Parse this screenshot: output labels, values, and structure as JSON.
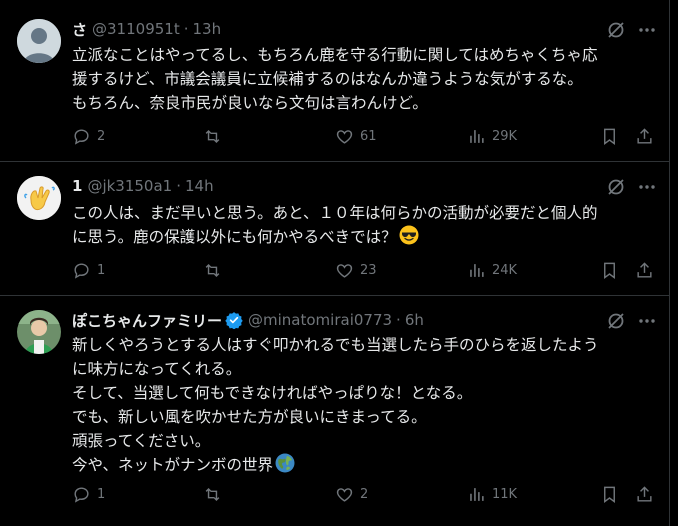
{
  "tweets": [
    {
      "name": "さ",
      "handle": "@3110951t",
      "dot": "·",
      "time": "13h",
      "lines": [
        "立派なことはやってるし、もちろん鹿を守る行動に関してはめちゃくちゃ応",
        "援するけど、市議会議員に立候補するのはなんか違うような気がするな。",
        "もちろん、奈良市民が良いなら文句は言わんけど。"
      ],
      "replies": "2",
      "reposts": "",
      "likes": "61",
      "views": "29K"
    },
    {
      "name": "1",
      "handle": "@jk3150a1",
      "dot": "·",
      "time": "14h",
      "lines": [
        "この人は、まだ早いと思う。あと、１０年は何らかの活動が必要だと個人的",
        "に思う。鹿の保護以外にも何かやるべきでは？"
      ],
      "emoji": "smiling-face-with-sunglasses",
      "replies": "1",
      "reposts": "",
      "likes": "23",
      "views": "24K"
    },
    {
      "name": "ぽこちゃんファミリー",
      "handle": "@minatomirai0773",
      "dot": "·",
      "time": "6h",
      "verified": true,
      "lines": [
        "新しくやろうとする人はすぐ叩かれるでも当選したら手のひらを返したよう",
        "に味方になってくれる。",
        "そして、当選して何もできなければやっぱりな！となる。",
        "でも、新しい風を吹かせた方が良いにきまってる。",
        "頑張ってください。",
        "今や、ネットがナンボの世界"
      ],
      "emoji": "globe-icon",
      "replies": "1",
      "reposts": "",
      "likes": "2",
      "views": "11K"
    }
  ],
  "colors": {
    "background": "#000000",
    "text": "#e7e9ea",
    "muted": "#71767b",
    "divider": "#2f3336",
    "verified": "#1d9bf0"
  }
}
